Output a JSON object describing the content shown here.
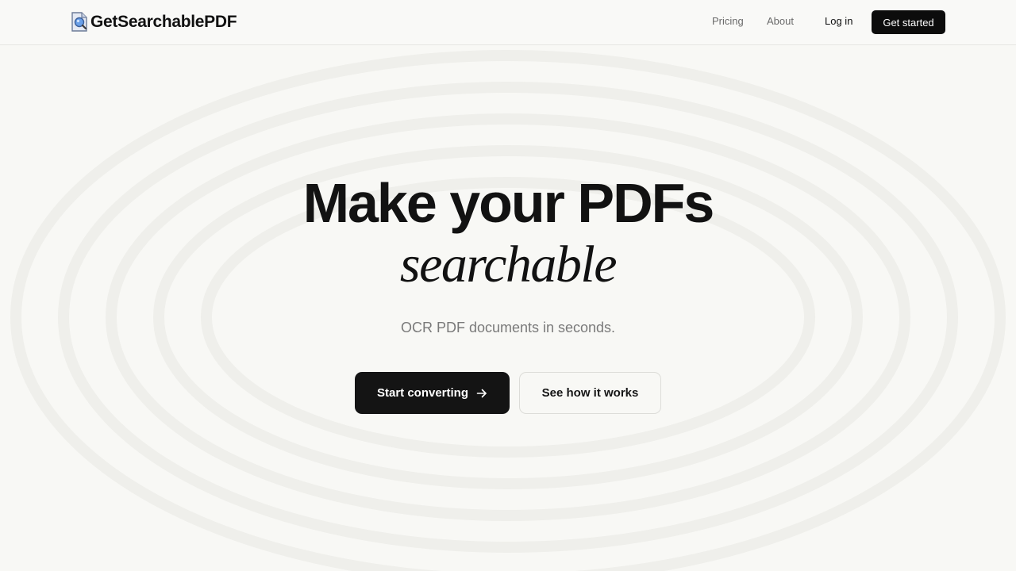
{
  "brand": {
    "name": "GetSearchablePDF",
    "logo_icon": "document-search-icon"
  },
  "nav": {
    "links": [
      {
        "label": "Pricing"
      },
      {
        "label": "About"
      }
    ],
    "login_label": "Log in",
    "cta_label": "Get started"
  },
  "hero": {
    "title": "Make your PDFs",
    "title_italic": "searchable",
    "subtitle": "OCR PDF documents in seconds.",
    "primary_cta": "Start converting",
    "primary_icon": "arrow-right-icon",
    "secondary_cta": "See how it works"
  },
  "colors": {
    "background": "#f8f8f5",
    "text": "#111111",
    "muted": "#7a7a7a",
    "button_dark": "#141414",
    "border": "#dcdcd8"
  }
}
